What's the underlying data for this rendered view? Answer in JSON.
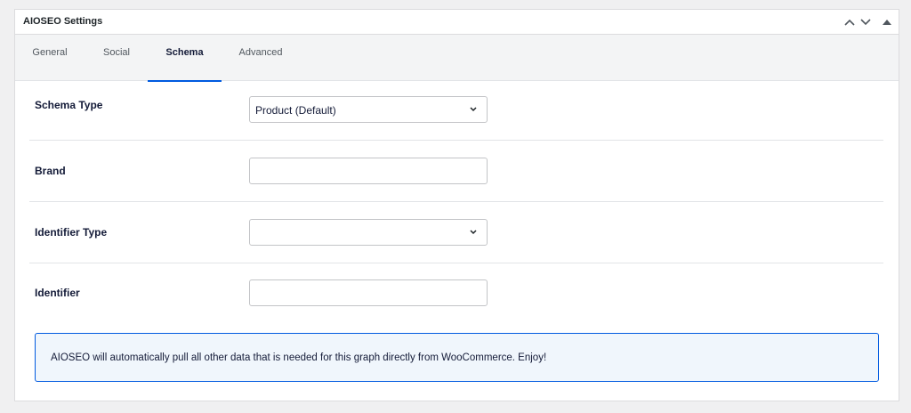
{
  "panel": {
    "title": "AIOSEO Settings"
  },
  "header_icons": [
    "chevron-up-icon",
    "chevron-down-icon",
    "triangle-up-icon"
  ],
  "tabs": [
    {
      "label": "General",
      "active": false
    },
    {
      "label": "Social",
      "active": false
    },
    {
      "label": "Schema",
      "active": true
    },
    {
      "label": "Advanced",
      "active": false
    }
  ],
  "fields": {
    "schema_type": {
      "label": "Schema Type",
      "value": "Product (Default)"
    },
    "brand": {
      "label": "Brand",
      "value": ""
    },
    "identifier_type": {
      "label": "Identifier Type",
      "value": ""
    },
    "identifier": {
      "label": "Identifier",
      "value": ""
    }
  },
  "notice": {
    "text": "AIOSEO will automatically pull all other data that is needed for this graph directly from WooCommerce. Enjoy!"
  },
  "colors": {
    "accent": "#005ae0",
    "notice_bg": "#f0f6fc",
    "tab_bar_bg": "#f3f4f5"
  }
}
